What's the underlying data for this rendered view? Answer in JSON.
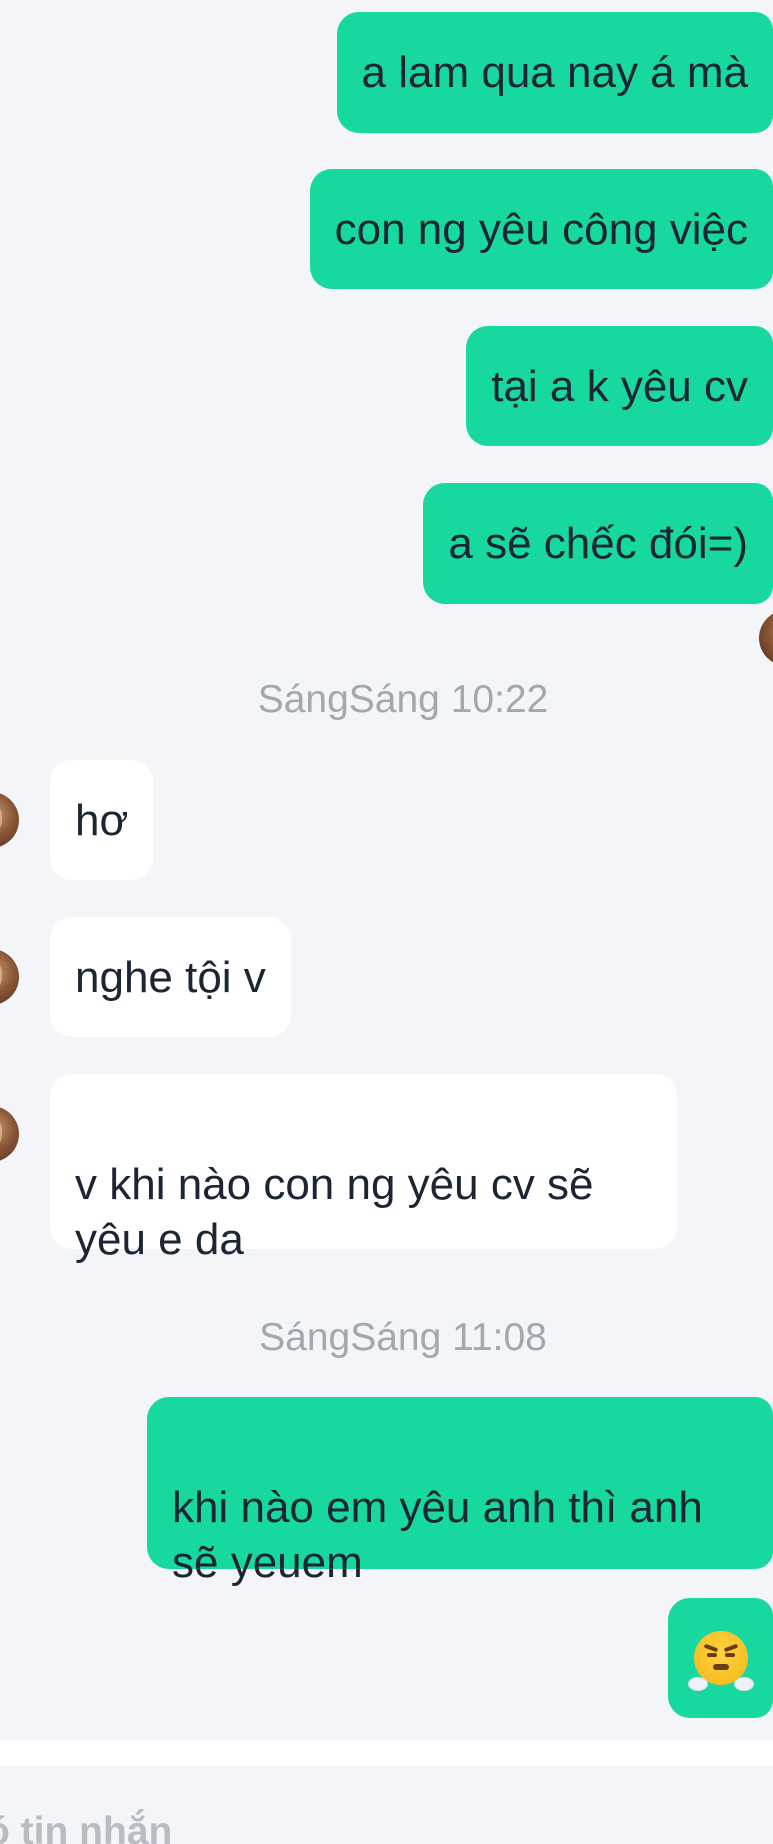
{
  "messages": [
    {
      "direction": "out",
      "text": "a lam qua nay á mà"
    },
    {
      "direction": "out",
      "text": "con ng yêu công việc"
    },
    {
      "direction": "out",
      "text": "tại a k yêu cv"
    },
    {
      "direction": "out",
      "text": "a sẽ chếc đói=)"
    },
    {
      "type": "timestamp",
      "text": "SángSáng 10:22"
    },
    {
      "direction": "in",
      "text": "hơ"
    },
    {
      "direction": "in",
      "text": "nghe tội v"
    },
    {
      "direction": "in",
      "text": "v khi nào con ng yêu cv sẽ\nyêu e da"
    },
    {
      "type": "timestamp",
      "text": "SángSáng 11:08"
    },
    {
      "direction": "out",
      "text": "khi nào em yêu anh thì anh\nsẽ yeuem"
    },
    {
      "direction": "out",
      "type": "emoji",
      "icon": "huffing-face-emoji"
    }
  ],
  "composer": {
    "placeholder": "ó tin nhắn"
  },
  "colors": {
    "outgoing_bubble": "#17d89e",
    "incoming_bubble": "#ffffff",
    "background": "#f3f5f8",
    "timestamp_text": "#a3a8b0",
    "message_text": "#1b2533"
  }
}
